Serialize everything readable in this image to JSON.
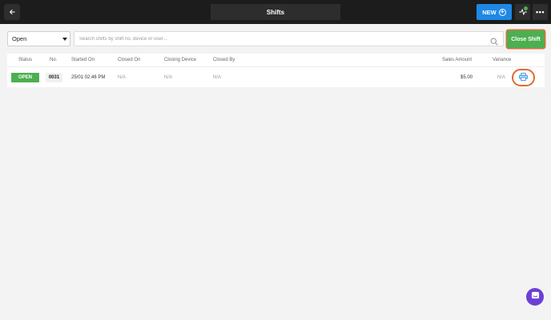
{
  "header": {
    "title": "Shifts",
    "new_label": "NEW"
  },
  "filters": {
    "status_selected": "Open",
    "search_placeholder": "Search shifts by shift no, device or user...",
    "close_shift_label": "Close Shift"
  },
  "table": {
    "columns": [
      "Status",
      "No.",
      "Started On",
      "Closed On",
      "Closing Device",
      "Closed By",
      "Sales Amount",
      "Variance"
    ],
    "rows": [
      {
        "status": "OPEN",
        "no": "0031",
        "started_on": "25/01 02:46 PM",
        "closed_on": "N/A",
        "closing_device": "N/A",
        "closed_by": "N/A",
        "sales_amount": "$5.00",
        "variance": "N/A"
      }
    ]
  },
  "colors": {
    "topbar": "#1c1c1c",
    "primary_blue": "#1e88e5",
    "success_green": "#4caf50",
    "highlight_orange": "#e36a2e",
    "chat_purple": "#6b3fd6"
  }
}
